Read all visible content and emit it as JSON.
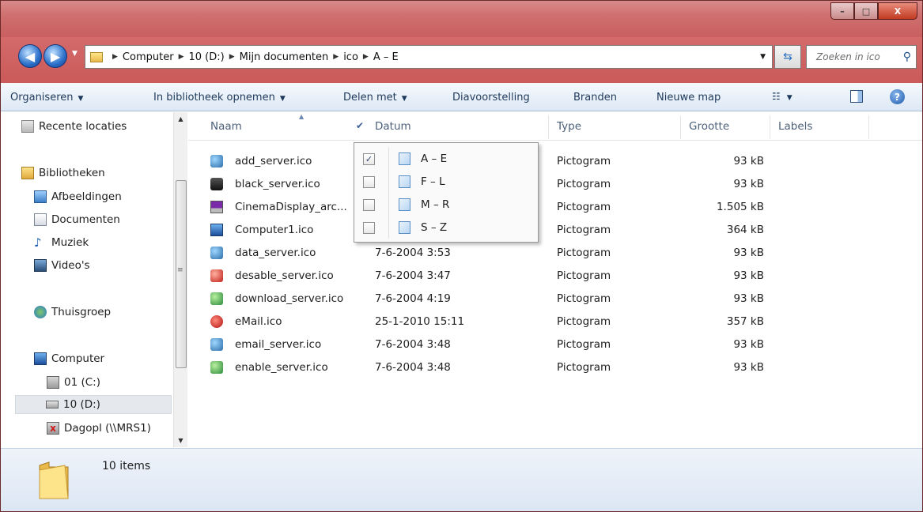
{
  "window": {
    "caption": {
      "minimize": "–",
      "maximize": "□",
      "close": "X"
    }
  },
  "address": {
    "crumbs": [
      "Computer",
      "10 (D:)",
      "Mijn documenten",
      "ico",
      "A – E"
    ],
    "search_placeholder": "Zoeken in ico"
  },
  "toolbar": {
    "organize": "Organiseren",
    "library": "In bibliotheek opnemen",
    "share": "Delen met",
    "slideshow": "Diavoorstelling",
    "burn": "Branden",
    "new_folder": "Nieuwe map"
  },
  "sidebar": {
    "items": [
      {
        "label": "Recente locaties",
        "icon": "recent-places-icon"
      },
      {
        "label": "Bibliotheken",
        "icon": "libraries-icon"
      },
      {
        "label": "Afbeeldingen",
        "icon": "pictures-icon"
      },
      {
        "label": "Documenten",
        "icon": "documents-icon"
      },
      {
        "label": "Muziek",
        "icon": "music-icon"
      },
      {
        "label": "Video's",
        "icon": "videos-icon"
      },
      {
        "label": "Thuisgroep",
        "icon": "homegroup-icon"
      },
      {
        "label": "Computer",
        "icon": "computer-icon"
      },
      {
        "label": "01 (C:)",
        "icon": "drive-c-icon"
      },
      {
        "label": "10 (D:)",
        "icon": "drive-d-icon"
      },
      {
        "label": "Dagopl (\\\\MRS1)",
        "icon": "network-drive-disconnected-icon"
      }
    ]
  },
  "columns": {
    "name": "Naam",
    "date": "Datum",
    "type": "Type",
    "size": "Grootte",
    "labels": "Labels"
  },
  "files": [
    {
      "name": "add_server.ico",
      "date": "",
      "type": "Pictogram",
      "size": "93 kB",
      "icon": "server-add-icon"
    },
    {
      "name": "black_server.ico",
      "date": "",
      "type": "Pictogram",
      "size": "93 kB",
      "icon": "server-black-icon"
    },
    {
      "name": "CinemaDisplay_arc...",
      "date": "",
      "type": "Pictogram",
      "size": "1.505 kB",
      "icon": "monitor-icon"
    },
    {
      "name": "Computer1.ico",
      "date": "",
      "type": "Pictogram",
      "size": "364 kB",
      "icon": "computer-icon"
    },
    {
      "name": "data_server.ico",
      "date": "7-6-2004 3:53",
      "type": "Pictogram",
      "size": "93 kB",
      "icon": "server-data-icon"
    },
    {
      "name": "desable_server.ico",
      "date": "7-6-2004 3:47",
      "type": "Pictogram",
      "size": "93 kB",
      "icon": "server-disable-icon"
    },
    {
      "name": "download_server.ico",
      "date": "7-6-2004 4:19",
      "type": "Pictogram",
      "size": "93 kB",
      "icon": "server-download-icon"
    },
    {
      "name": "eMail.ico",
      "date": "25-1-2010 15:11",
      "type": "Pictogram",
      "size": "357 kB",
      "icon": "email-icon"
    },
    {
      "name": "email_server.ico",
      "date": "7-6-2004 3:48",
      "type": "Pictogram",
      "size": "93 kB",
      "icon": "server-email-icon"
    },
    {
      "name": "enable_server.ico",
      "date": "7-6-2004 3:48",
      "type": "Pictogram",
      "size": "93 kB",
      "icon": "server-enable-icon"
    }
  ],
  "group_popup": {
    "items": [
      {
        "label": "A – E",
        "checked": true
      },
      {
        "label": "F – L",
        "checked": false
      },
      {
        "label": "M – R",
        "checked": false
      },
      {
        "label": "S – Z",
        "checked": false
      }
    ]
  },
  "status": {
    "count": "10 items"
  },
  "colors": {
    "title_bar": "#cf6f6f",
    "toolbar_text": "#1e395b",
    "header_text": "#4c607a"
  }
}
